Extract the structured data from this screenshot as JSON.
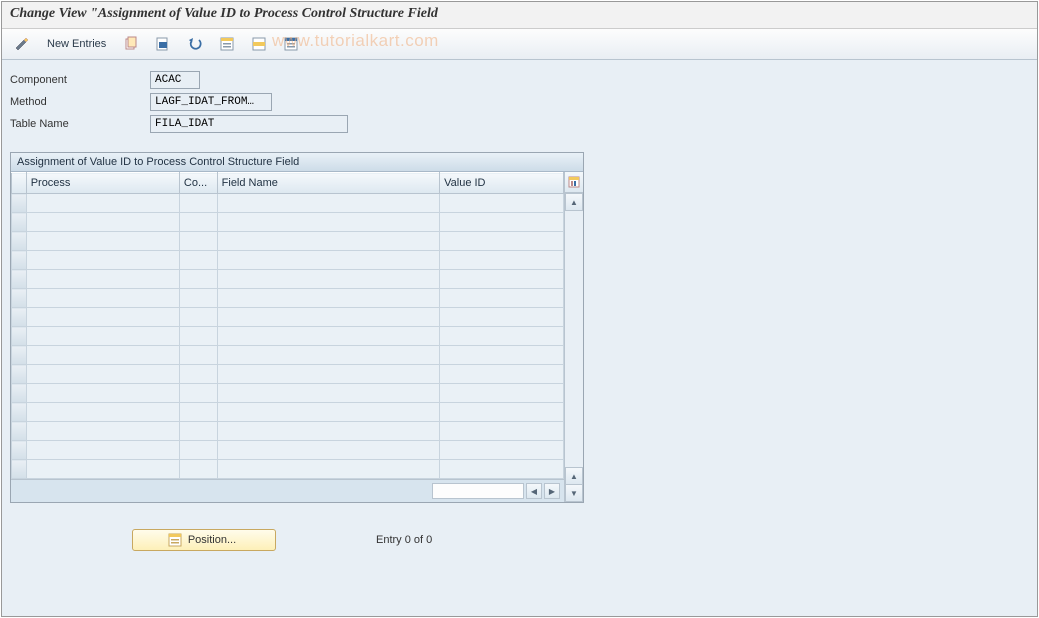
{
  "title": "Change View \"Assignment of Value ID to Process Control Structure Field",
  "watermark": "www.tutorialkart.com",
  "toolbar": {
    "new_entries_label": "New Entries"
  },
  "header_fields": {
    "component_label": "Component",
    "component_value": "ACAC",
    "method_label": "Method",
    "method_value": "LAGF_IDAT_FROM…",
    "table_label": "Table Name",
    "table_value": "FILA_IDAT"
  },
  "grid": {
    "title": "Assignment of Value ID to Process Control Structure Field",
    "columns": {
      "process": "Process",
      "co": "Co...",
      "field_name": "Field Name",
      "value_id": "Value ID"
    },
    "row_count": 15
  },
  "footer": {
    "position_label": "Position...",
    "entry_text": "Entry 0 of 0"
  }
}
